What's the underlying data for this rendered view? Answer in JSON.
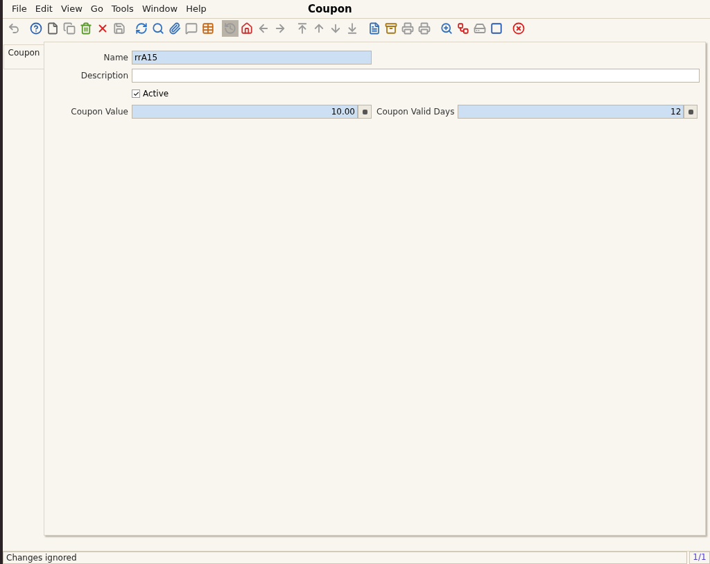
{
  "window": {
    "title": "Coupon"
  },
  "menu": [
    "File",
    "Edit",
    "View",
    "Go",
    "Tools",
    "Window",
    "Help"
  ],
  "toolbar": [
    [
      {
        "kind": "undo",
        "disabled": true,
        "selected": false
      }
    ],
    [
      {
        "kind": "help",
        "disabled": false,
        "selected": false
      },
      {
        "kind": "new",
        "disabled": false,
        "selected": false
      },
      {
        "kind": "copy",
        "disabled": true,
        "selected": false
      },
      {
        "kind": "trash",
        "disabled": false,
        "selected": false
      },
      {
        "kind": "delete",
        "disabled": false,
        "selected": false
      },
      {
        "kind": "save",
        "disabled": true,
        "selected": false
      }
    ],
    [
      {
        "kind": "refresh",
        "disabled": false,
        "selected": false
      },
      {
        "kind": "search",
        "disabled": false,
        "selected": false
      },
      {
        "kind": "attach",
        "disabled": false,
        "selected": false
      },
      {
        "kind": "chat",
        "disabled": true,
        "selected": false
      },
      {
        "kind": "table",
        "disabled": false,
        "selected": false
      }
    ],
    [
      {
        "kind": "history",
        "disabled": true,
        "selected": true
      },
      {
        "kind": "home",
        "disabled": false,
        "selected": false
      },
      {
        "kind": "left",
        "disabled": true,
        "selected": false
      },
      {
        "kind": "right",
        "disabled": true,
        "selected": false
      }
    ],
    [
      {
        "kind": "first",
        "disabled": true,
        "selected": false
      },
      {
        "kind": "up",
        "disabled": true,
        "selected": false
      },
      {
        "kind": "down",
        "disabled": true,
        "selected": false
      },
      {
        "kind": "last",
        "disabled": true,
        "selected": false
      }
    ],
    [
      {
        "kind": "report",
        "disabled": false,
        "selected": false
      },
      {
        "kind": "archive",
        "disabled": false,
        "selected": false
      },
      {
        "kind": "print",
        "disabled": true,
        "selected": false
      },
      {
        "kind": "print",
        "disabled": true,
        "selected": false
      }
    ],
    [
      {
        "kind": "zoom",
        "disabled": false,
        "selected": false
      },
      {
        "kind": "workflow",
        "disabled": false,
        "selected": false
      },
      {
        "kind": "request",
        "disabled": true,
        "selected": false
      },
      {
        "kind": "product",
        "disabled": false,
        "selected": false
      }
    ],
    [
      {
        "kind": "close",
        "disabled": false,
        "selected": false
      }
    ]
  ],
  "tabs": [
    {
      "label": "Coupon",
      "selected": true
    }
  ],
  "form": {
    "name": {
      "label": "Name",
      "value": "rrA15"
    },
    "description": {
      "label": "Description"
    },
    "active": {
      "label": "Active",
      "checked": true
    },
    "coupon_value": {
      "label": "Coupon Value",
      "value": "10.00"
    },
    "coupon_valid_days": {
      "label": "Coupon Valid Days",
      "value": "12"
    }
  },
  "status_bar": {
    "message": "Changes ignored",
    "record": "1/1"
  }
}
